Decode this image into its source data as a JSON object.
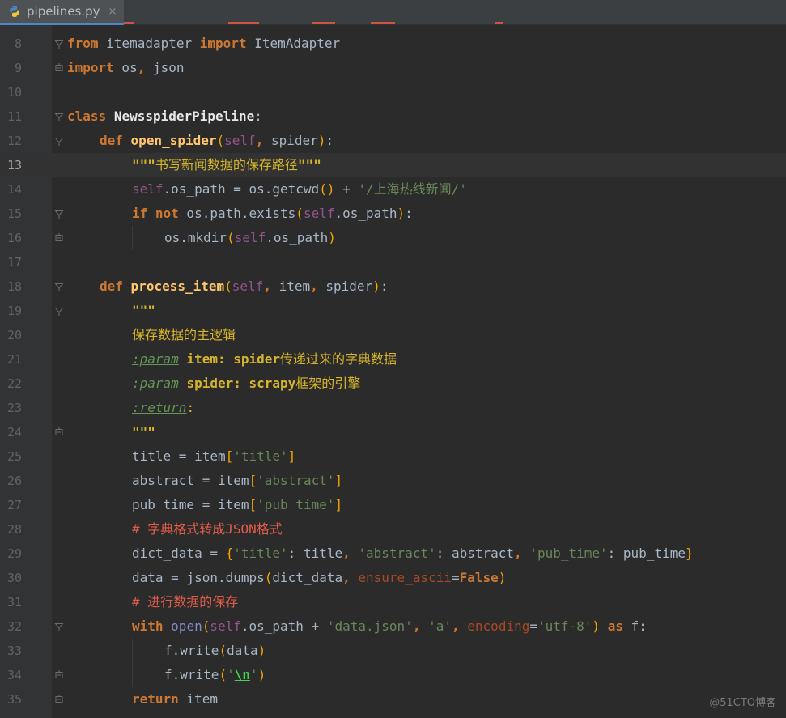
{
  "tab": {
    "filename": "pipelines.py",
    "close": "×"
  },
  "colors": {
    "background": "#2b2b2b",
    "gutter": "#313335",
    "keyword": "#cc7832",
    "function": "#ffc66d",
    "self": "#94558d",
    "string": "#6a8759",
    "docstring": "#d6b52a",
    "comment": "#e05c4a",
    "builtin": "#8888c6",
    "param": "#aa4926",
    "bracket": "#f2a400",
    "escape": "#3fd74e"
  },
  "current_line": 13,
  "watermark": "@51CTO博客",
  "lines": [
    {
      "num": "8",
      "fold": "open",
      "indent": 0,
      "segs": [
        {
          "c": "kw",
          "t": "from"
        },
        {
          "t": " itemadapter "
        },
        {
          "c": "kw",
          "t": "import"
        },
        {
          "t": " ItemAdapter"
        }
      ]
    },
    {
      "num": "9",
      "fold": "end",
      "indent": 0,
      "segs": [
        {
          "c": "kw",
          "t": "import"
        },
        {
          "t": " os"
        },
        {
          "c": "kw",
          "t": ","
        },
        {
          "t": " json"
        }
      ]
    },
    {
      "num": "10",
      "fold": "",
      "indent": 0,
      "segs": []
    },
    {
      "num": "11",
      "fold": "open",
      "indent": 0,
      "segs": [
        {
          "c": "kw",
          "t": "class"
        },
        {
          "t": " "
        },
        {
          "c": "fnw",
          "t": "NewsspiderPipeline"
        },
        {
          "t": ":"
        }
      ]
    },
    {
      "num": "12",
      "fold": "open",
      "indent": 1,
      "segs": [
        {
          "c": "kw",
          "t": "def"
        },
        {
          "t": " "
        },
        {
          "c": "fn",
          "t": "open_spider"
        },
        {
          "c": "br",
          "t": "("
        },
        {
          "c": "sf",
          "t": "self"
        },
        {
          "c": "kw",
          "t": ","
        },
        {
          "t": " spider"
        },
        {
          "c": "br",
          "t": ")"
        },
        {
          "t": ":"
        }
      ]
    },
    {
      "num": "13",
      "fold": "",
      "indent": 2,
      "segs": [
        {
          "c": "docb",
          "t": "\"\"\""
        },
        {
          "c": "doc",
          "t": "书写新闻数据的保存路径"
        },
        {
          "c": "docb",
          "t": "\"\"\""
        }
      ]
    },
    {
      "num": "14",
      "fold": "",
      "indent": 2,
      "segs": [
        {
          "c": "sf",
          "t": "self"
        },
        {
          "t": ".os_path = os.getcwd"
        },
        {
          "c": "br",
          "t": "()"
        },
        {
          "t": " + "
        },
        {
          "c": "st",
          "t": "'/上海热线新闻/'"
        }
      ]
    },
    {
      "num": "15",
      "fold": "open",
      "indent": 2,
      "segs": [
        {
          "c": "kw",
          "t": "if not"
        },
        {
          "t": " os.path.exists"
        },
        {
          "c": "br",
          "t": "("
        },
        {
          "c": "sf",
          "t": "self"
        },
        {
          "t": ".os_path"
        },
        {
          "c": "br",
          "t": ")"
        },
        {
          "t": ":"
        }
      ]
    },
    {
      "num": "16",
      "fold": "end",
      "indent": 3,
      "segs": [
        {
          "t": "os.mkdir"
        },
        {
          "c": "br",
          "t": "("
        },
        {
          "c": "sf",
          "t": "self"
        },
        {
          "t": ".os_path"
        },
        {
          "c": "br",
          "t": ")"
        }
      ]
    },
    {
      "num": "17",
      "fold": "",
      "indent": 0,
      "segs": []
    },
    {
      "num": "18",
      "fold": "open",
      "indent": 1,
      "segs": [
        {
          "c": "kw",
          "t": "def"
        },
        {
          "t": " "
        },
        {
          "c": "fn",
          "t": "process_item"
        },
        {
          "c": "br",
          "t": "("
        },
        {
          "c": "sf",
          "t": "self"
        },
        {
          "c": "kw",
          "t": ","
        },
        {
          "t": " item"
        },
        {
          "c": "kw",
          "t": ","
        },
        {
          "t": " spider"
        },
        {
          "c": "br",
          "t": ")"
        },
        {
          "t": ":"
        }
      ]
    },
    {
      "num": "19",
      "fold": "open",
      "indent": 2,
      "segs": [
        {
          "c": "docb",
          "t": "\"\"\""
        }
      ]
    },
    {
      "num": "20",
      "fold": "",
      "indent": 2,
      "segs": [
        {
          "c": "doc",
          "t": "保存数据的主逻辑"
        }
      ]
    },
    {
      "num": "21",
      "fold": "",
      "indent": 2,
      "segs": [
        {
          "c": "dtag",
          "t": ":param"
        },
        {
          "t": " "
        },
        {
          "c": "docb",
          "t": "item: spider"
        },
        {
          "c": "doc",
          "t": "传递过来的字典数据"
        }
      ]
    },
    {
      "num": "22",
      "fold": "",
      "indent": 2,
      "segs": [
        {
          "c": "dtag",
          "t": ":param"
        },
        {
          "t": " "
        },
        {
          "c": "docb",
          "t": "spider: scrapy"
        },
        {
          "c": "doc",
          "t": "框架的引擎"
        }
      ]
    },
    {
      "num": "23",
      "fold": "",
      "indent": 2,
      "segs": [
        {
          "c": "dtag",
          "t": ":return"
        },
        {
          "c": "doc",
          "t": ":"
        }
      ]
    },
    {
      "num": "24",
      "fold": "end",
      "indent": 2,
      "segs": [
        {
          "c": "docb",
          "t": "\"\"\""
        }
      ]
    },
    {
      "num": "25",
      "fold": "",
      "indent": 2,
      "segs": [
        {
          "t": "title = item"
        },
        {
          "c": "br",
          "t": "["
        },
        {
          "c": "st",
          "t": "'title'"
        },
        {
          "c": "br",
          "t": "]"
        }
      ]
    },
    {
      "num": "26",
      "fold": "",
      "indent": 2,
      "segs": [
        {
          "t": "abstract = item"
        },
        {
          "c": "br",
          "t": "["
        },
        {
          "c": "st",
          "t": "'abstract'"
        },
        {
          "c": "br",
          "t": "]"
        }
      ]
    },
    {
      "num": "27",
      "fold": "",
      "indent": 2,
      "segs": [
        {
          "t": "pub_time = item"
        },
        {
          "c": "br",
          "t": "["
        },
        {
          "c": "st",
          "t": "'pub_time'"
        },
        {
          "c": "br",
          "t": "]"
        }
      ]
    },
    {
      "num": "28",
      "fold": "",
      "indent": 2,
      "segs": [
        {
          "c": "cm",
          "t": "# 字典格式转成JSON格式"
        }
      ]
    },
    {
      "num": "29",
      "fold": "",
      "indent": 2,
      "segs": [
        {
          "t": "dict_data = "
        },
        {
          "c": "br",
          "t": "{"
        },
        {
          "c": "st",
          "t": "'title'"
        },
        {
          "t": ": title"
        },
        {
          "c": "kw",
          "t": ","
        },
        {
          "t": " "
        },
        {
          "c": "st",
          "t": "'abstract'"
        },
        {
          "t": ": abstract"
        },
        {
          "c": "kw",
          "t": ","
        },
        {
          "t": " "
        },
        {
          "c": "st",
          "t": "'pub_time'"
        },
        {
          "t": ": pub_time"
        },
        {
          "c": "br",
          "t": "}"
        }
      ]
    },
    {
      "num": "30",
      "fold": "",
      "indent": 2,
      "segs": [
        {
          "t": "data = json.dumps"
        },
        {
          "c": "br",
          "t": "("
        },
        {
          "t": "dict_data"
        },
        {
          "c": "kw",
          "t": ","
        },
        {
          "t": " "
        },
        {
          "c": "pa",
          "t": "ensure_ascii"
        },
        {
          "t": "="
        },
        {
          "c": "kw",
          "t": "False"
        },
        {
          "c": "br",
          "t": ")"
        }
      ]
    },
    {
      "num": "31",
      "fold": "",
      "indent": 2,
      "segs": [
        {
          "c": "cm",
          "t": "# 进行数据的保存"
        }
      ]
    },
    {
      "num": "32",
      "fold": "open",
      "indent": 2,
      "segs": [
        {
          "c": "kw",
          "t": "with"
        },
        {
          "t": " "
        },
        {
          "c": "bi",
          "t": "open"
        },
        {
          "c": "br",
          "t": "("
        },
        {
          "c": "sf",
          "t": "self"
        },
        {
          "t": ".os_path + "
        },
        {
          "c": "st",
          "t": "'data.json'"
        },
        {
          "c": "kw",
          "t": ","
        },
        {
          "t": " "
        },
        {
          "c": "st",
          "t": "'a'"
        },
        {
          "c": "kw",
          "t": ","
        },
        {
          "t": " "
        },
        {
          "c": "pa",
          "t": "encoding"
        },
        {
          "t": "="
        },
        {
          "c": "st",
          "t": "'utf-8'"
        },
        {
          "c": "br",
          "t": ")"
        },
        {
          "t": " "
        },
        {
          "c": "kw",
          "t": "as"
        },
        {
          "t": " f:"
        }
      ]
    },
    {
      "num": "33",
      "fold": "",
      "indent": 3,
      "segs": [
        {
          "t": "f.write"
        },
        {
          "c": "br",
          "t": "("
        },
        {
          "t": "data"
        },
        {
          "c": "br",
          "t": ")"
        }
      ]
    },
    {
      "num": "34",
      "fold": "end",
      "indent": 3,
      "segs": [
        {
          "t": "f.write"
        },
        {
          "c": "br",
          "t": "("
        },
        {
          "c": "st",
          "t": "'"
        },
        {
          "c": "esc",
          "t": "\\n"
        },
        {
          "c": "st",
          "t": "'"
        },
        {
          "c": "br",
          "t": ")"
        }
      ]
    },
    {
      "num": "35",
      "fold": "end",
      "indent": 2,
      "segs": [
        {
          "c": "kw",
          "t": "return"
        },
        {
          "t": " item"
        }
      ]
    }
  ]
}
